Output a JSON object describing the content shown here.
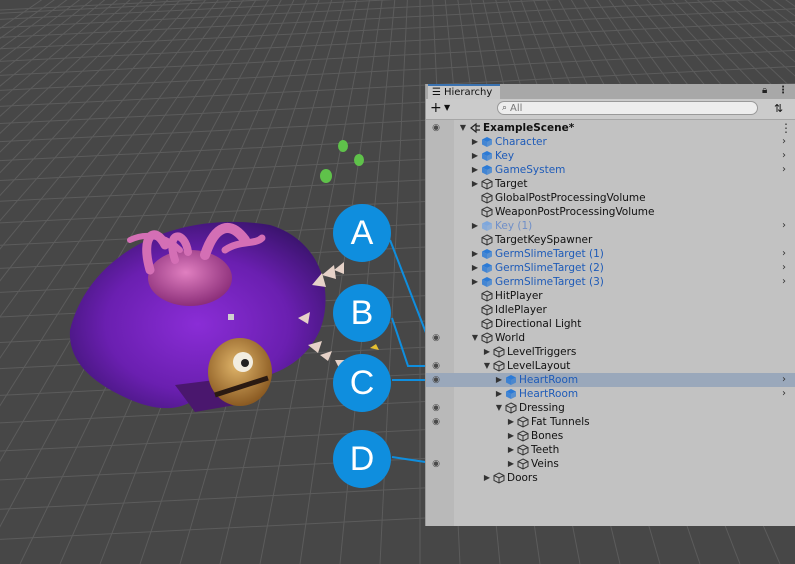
{
  "panel": {
    "tab_title": "Hierarchy",
    "add_label": "+",
    "search_placeholder": "All",
    "scene_name": "ExampleScene*"
  },
  "icons": {
    "tab": "list-icon",
    "lock": "lock-icon",
    "more": "kebab-menu-icon",
    "search": "search-icon",
    "prefab": "blue-cube-icon",
    "gameobject": "cube-outline-icon",
    "visibility": "eye-icon"
  },
  "colors": {
    "selection": "#9aa8bb",
    "prefab_text": "#1e5bb8",
    "callout": "#0f8ede",
    "panel_bg": "#c2c2c2",
    "scene_bg": "#474747"
  },
  "rows": [
    {
      "label": "ExampleScene*"
    },
    {
      "label": "Character"
    },
    {
      "label": "Key"
    },
    {
      "label": "GameSystem"
    },
    {
      "label": "Target"
    },
    {
      "label": "GlobalPostProcessingVolume"
    },
    {
      "label": "WeaponPostProcessingVolume"
    },
    {
      "label": "Key (1)"
    },
    {
      "label": "TargetKeySpawner"
    },
    {
      "label": "GermSlimeTarget (1)"
    },
    {
      "label": "GermSlimeTarget (2)"
    },
    {
      "label": "GermSlimeTarget (3)"
    },
    {
      "label": "HitPlayer"
    },
    {
      "label": "IdlePlayer"
    },
    {
      "label": "Directional Light"
    },
    {
      "label": "World"
    },
    {
      "label": "LevelTriggers"
    },
    {
      "label": "LevelLayout"
    },
    {
      "label": "HeartRoom"
    },
    {
      "label": "HeartRoom"
    },
    {
      "label": "Dressing"
    },
    {
      "label": "Fat Tunnels"
    },
    {
      "label": "Bones"
    },
    {
      "label": "Teeth"
    },
    {
      "label": "Veins"
    },
    {
      "label": "Doors"
    }
  ],
  "callouts": [
    {
      "letter": "A"
    },
    {
      "letter": "B"
    },
    {
      "letter": "C"
    },
    {
      "letter": "D"
    }
  ]
}
